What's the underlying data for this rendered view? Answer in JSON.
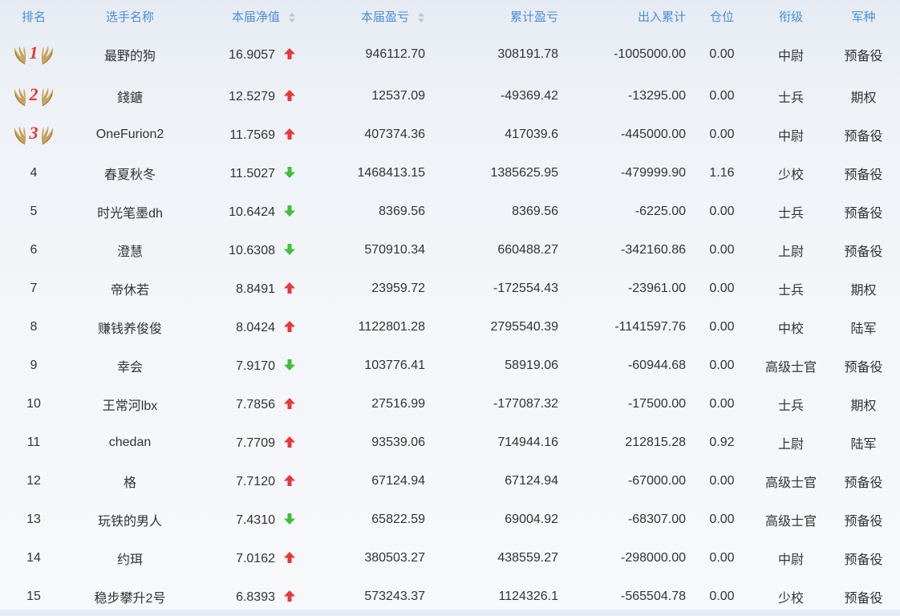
{
  "headers": {
    "rank": "排名",
    "name": "选手名称",
    "nav": "本届净值",
    "pnl": "本届盈亏",
    "cum_pnl": "累计盈亏",
    "flow": "出入累计",
    "position": "仓位",
    "grade": "衔级",
    "branch": "军种"
  },
  "colors": {
    "header_text": "#4a8fd8",
    "up_arrow": "#e8363c",
    "down_arrow": "#3fbf3a",
    "medal_wing": "#c8a45a",
    "medal_number": "#e8363c"
  },
  "rows": [
    {
      "rank": "1",
      "medal": true,
      "name": "最野的狗",
      "nav": "16.9057",
      "trend": "up",
      "pnl": "946112.70",
      "cum_pnl": "308191.78",
      "flow": "-1005000.00",
      "position": "0.00",
      "grade": "中尉",
      "branch": "预备役"
    },
    {
      "rank": "2",
      "medal": true,
      "name": "錢鎕",
      "nav": "12.5279",
      "trend": "up",
      "pnl": "12537.09",
      "cum_pnl": "-49369.42",
      "flow": "-13295.00",
      "position": "0.00",
      "grade": "士兵",
      "branch": "期权"
    },
    {
      "rank": "3",
      "medal": true,
      "name": "OneFurion2",
      "nav": "11.7569",
      "trend": "up",
      "pnl": "407374.36",
      "cum_pnl": "417039.6",
      "flow": "-445000.00",
      "position": "0.00",
      "grade": "中尉",
      "branch": "预备役"
    },
    {
      "rank": "4",
      "medal": false,
      "name": "春夏秋冬",
      "nav": "11.5027",
      "trend": "down",
      "pnl": "1468413.15",
      "cum_pnl": "1385625.95",
      "flow": "-479999.90",
      "position": "1.16",
      "grade": "少校",
      "branch": "预备役"
    },
    {
      "rank": "5",
      "medal": false,
      "name": "时光笔墨dh",
      "nav": "10.6424",
      "trend": "down",
      "pnl": "8369.56",
      "cum_pnl": "8369.56",
      "flow": "-6225.00",
      "position": "0.00",
      "grade": "士兵",
      "branch": "预备役"
    },
    {
      "rank": "6",
      "medal": false,
      "name": "澄慧",
      "nav": "10.6308",
      "trend": "down",
      "pnl": "570910.34",
      "cum_pnl": "660488.27",
      "flow": "-342160.86",
      "position": "0.00",
      "grade": "上尉",
      "branch": "预备役"
    },
    {
      "rank": "7",
      "medal": false,
      "name": "帝休若",
      "nav": "8.8491",
      "trend": "up",
      "pnl": "23959.72",
      "cum_pnl": "-172554.43",
      "flow": "-23961.00",
      "position": "0.00",
      "grade": "士兵",
      "branch": "期权"
    },
    {
      "rank": "8",
      "medal": false,
      "name": "赚钱养俊俊",
      "nav": "8.0424",
      "trend": "up",
      "pnl": "1122801.28",
      "cum_pnl": "2795540.39",
      "flow": "-1141597.76",
      "position": "0.00",
      "grade": "中校",
      "branch": "陆军"
    },
    {
      "rank": "9",
      "medal": false,
      "name": "幸会",
      "nav": "7.9170",
      "trend": "down",
      "pnl": "103776.41",
      "cum_pnl": "58919.06",
      "flow": "-60944.68",
      "position": "0.00",
      "grade": "高级士官",
      "branch": "预备役"
    },
    {
      "rank": "10",
      "medal": false,
      "name": "王常河lbx",
      "nav": "7.7856",
      "trend": "up",
      "pnl": "27516.99",
      "cum_pnl": "-177087.32",
      "flow": "-17500.00",
      "position": "0.00",
      "grade": "士兵",
      "branch": "期权"
    },
    {
      "rank": "11",
      "medal": false,
      "name": "chedan",
      "nav": "7.7709",
      "trend": "up",
      "pnl": "93539.06",
      "cum_pnl": "714944.16",
      "flow": "212815.28",
      "position": "0.92",
      "grade": "上尉",
      "branch": "陆军"
    },
    {
      "rank": "12",
      "medal": false,
      "name": "格",
      "nav": "7.7120",
      "trend": "up",
      "pnl": "67124.94",
      "cum_pnl": "67124.94",
      "flow": "-67000.00",
      "position": "0.00",
      "grade": "高级士官",
      "branch": "预备役"
    },
    {
      "rank": "13",
      "medal": false,
      "name": "玩铁的男人",
      "nav": "7.4310",
      "trend": "down",
      "pnl": "65822.59",
      "cum_pnl": "69004.92",
      "flow": "-68307.00",
      "position": "0.00",
      "grade": "高级士官",
      "branch": "预备役"
    },
    {
      "rank": "14",
      "medal": false,
      "name": "约珥",
      "nav": "7.0162",
      "trend": "up",
      "pnl": "380503.27",
      "cum_pnl": "438559.27",
      "flow": "-298000.00",
      "position": "0.00",
      "grade": "中尉",
      "branch": "预备役"
    },
    {
      "rank": "15",
      "medal": false,
      "name": "稳步攀升2号",
      "nav": "6.8393",
      "trend": "up",
      "pnl": "573243.37",
      "cum_pnl": "1124326.1",
      "flow": "-565504.78",
      "position": "0.00",
      "grade": "少校",
      "branch": "预备役"
    }
  ]
}
